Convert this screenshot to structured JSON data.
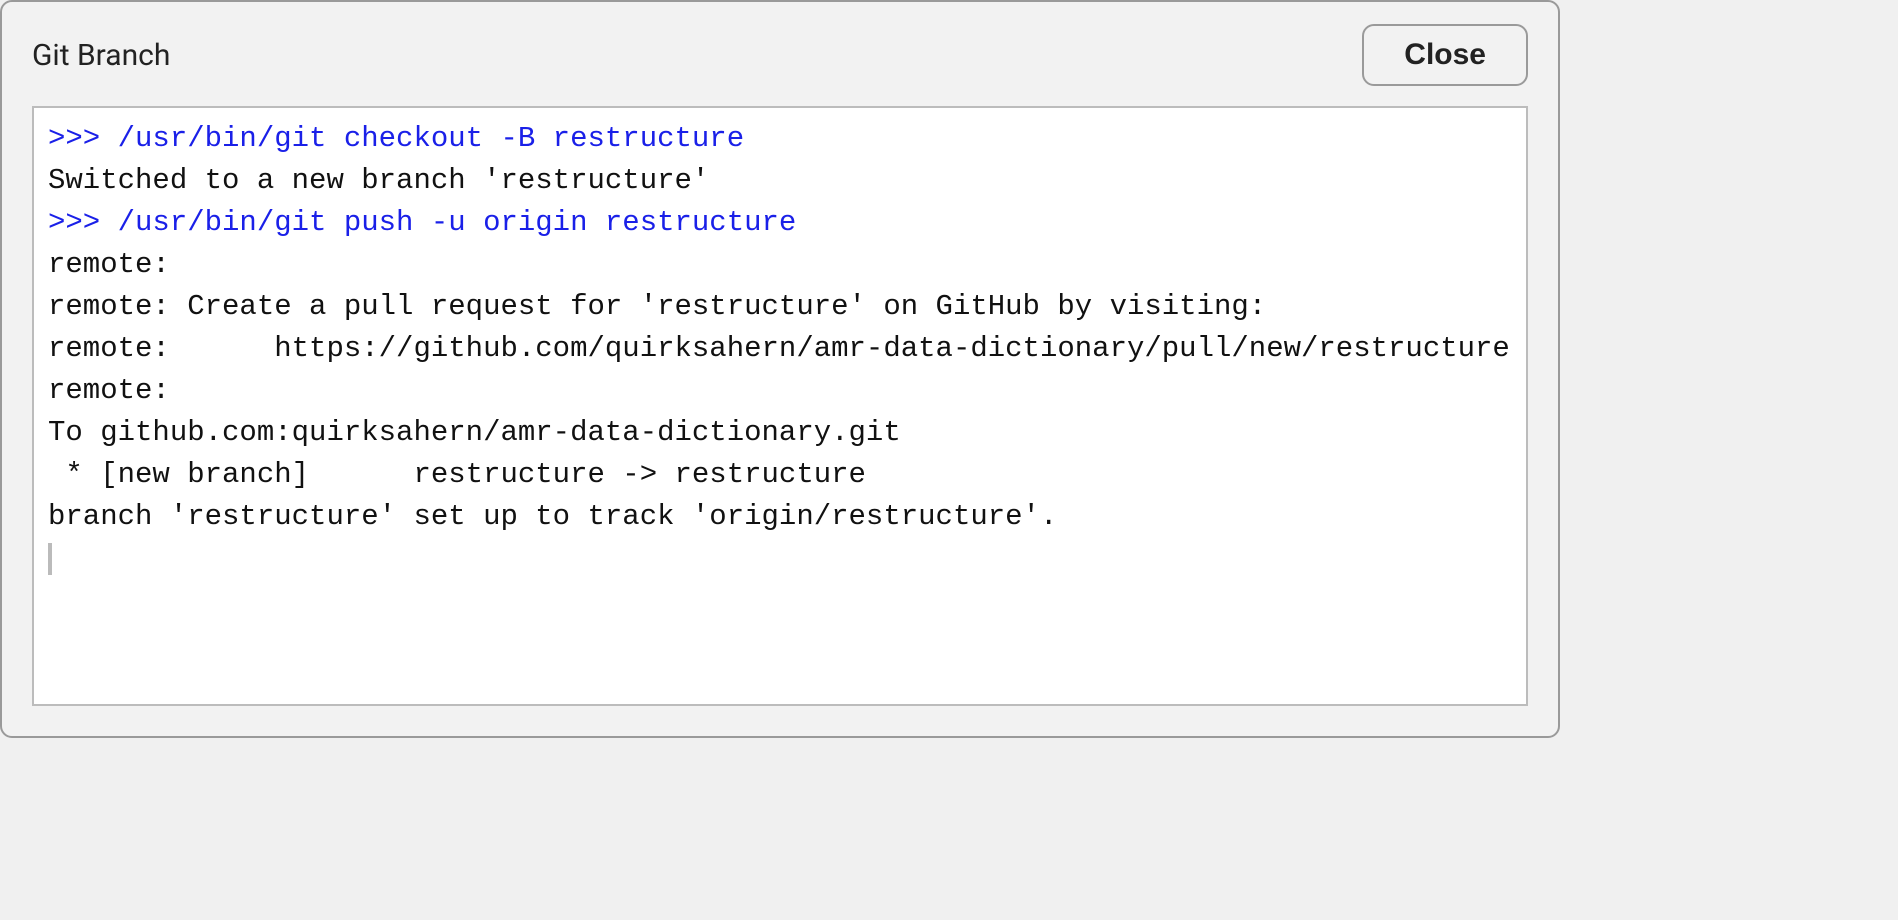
{
  "dialog": {
    "title": "Git Branch",
    "close_label": "Close"
  },
  "terminal": {
    "lines": [
      {
        "kind": "cmd",
        "text": ">>> /usr/bin/git checkout -B restructure"
      },
      {
        "kind": "out",
        "text": "Switched to a new branch 'restructure'"
      },
      {
        "kind": "cmd",
        "text": ">>> /usr/bin/git push -u origin restructure"
      },
      {
        "kind": "out",
        "text": "remote: "
      },
      {
        "kind": "out",
        "text": "remote: Create a pull request for 'restructure' on GitHub by visiting:"
      },
      {
        "kind": "out",
        "text": "remote:      https://github.com/quirksahern/amr-data-dictionary/pull/new/restructure"
      },
      {
        "kind": "out",
        "text": "remote: "
      },
      {
        "kind": "out",
        "text": "To github.com:quirksahern/amr-data-dictionary.git"
      },
      {
        "kind": "out",
        "text": " * [new branch]      restructure -> restructure"
      },
      {
        "kind": "out",
        "text": "branch 'restructure' set up to track 'origin/restructure'."
      }
    ]
  }
}
